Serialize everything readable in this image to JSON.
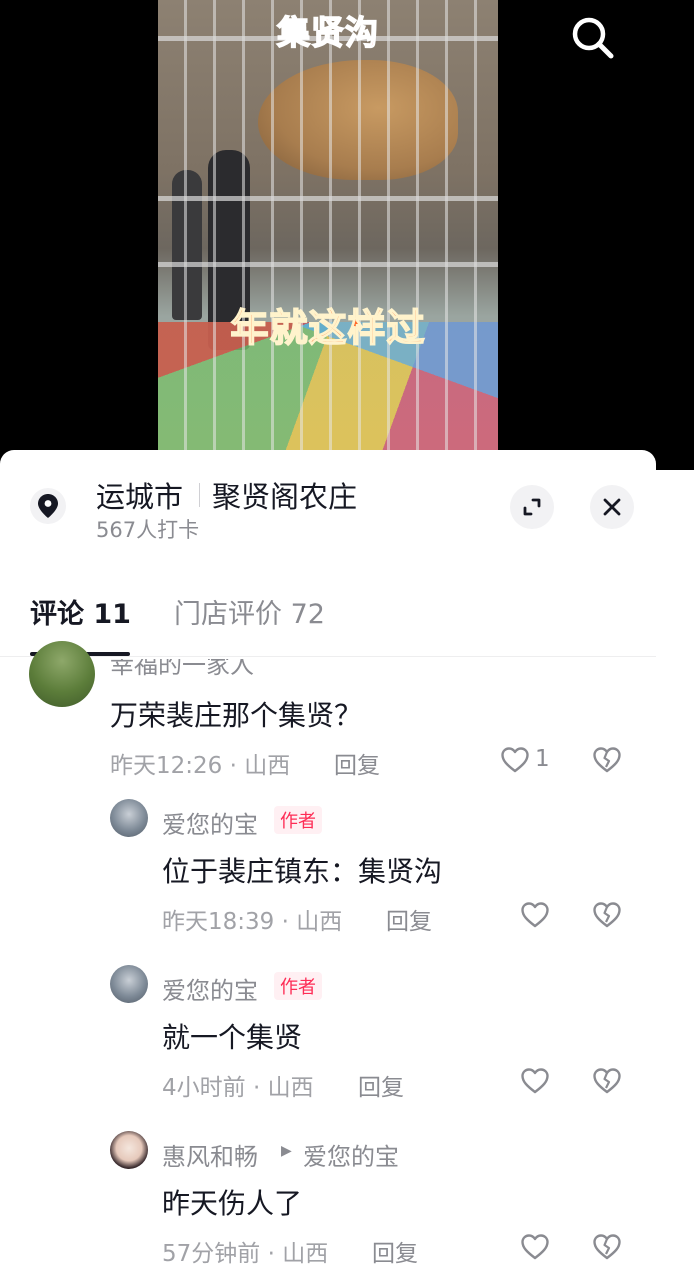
{
  "video": {
    "caption_top": "集贤沟",
    "caption_middle": "年就这样过"
  },
  "location": {
    "city": "运城市",
    "shop_name": "聚贤阁农庄",
    "checkin_count": "567人打卡"
  },
  "tabs": [
    {
      "label": "评论 11",
      "active": true
    },
    {
      "label": "门店评价 72",
      "active": false
    }
  ],
  "comments": [
    {
      "author": "幸福的一家人",
      "text": "万荣裴庄那个集贤？",
      "meta": "昨天12:26 · 山西",
      "reply_label": "回复",
      "like_count": "1",
      "replies": [
        {
          "author": "爱您的宝",
          "badge": "作者",
          "text": "位于裴庄镇东：集贤沟",
          "meta": "昨天18:39 · 山西",
          "reply_label": "回复"
        },
        {
          "author": "爱您的宝",
          "badge": "作者",
          "text": "就一个集贤",
          "meta": "4小时前 · 山西",
          "reply_label": "回复"
        },
        {
          "author": "惠风和畅",
          "reply_to": "爱您的宝",
          "text": "昨天伤人了",
          "meta": "57分钟前 · 山西",
          "reply_label": "回复"
        }
      ]
    }
  ],
  "icons": {
    "search": "search-icon",
    "location": "location-pin-icon",
    "expand": "expand-icon",
    "close": "close-icon",
    "like": "heart-icon",
    "dislike": "broken-heart-icon",
    "reply_arrow": "triangle-right-icon"
  },
  "colors": {
    "accent_red": "#fe2c55",
    "text_primary": "#161823",
    "text_secondary": "#8a8b91"
  }
}
